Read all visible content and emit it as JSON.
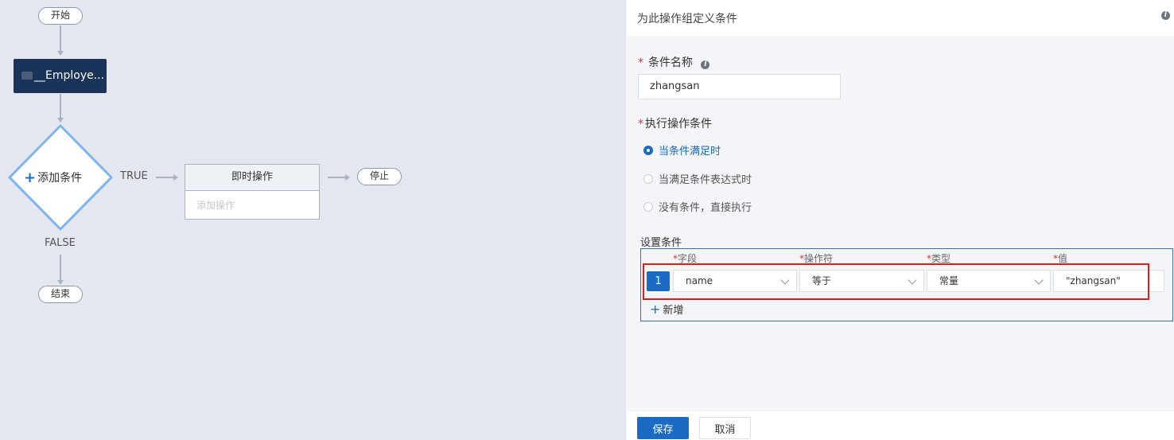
{
  "flow": {
    "start_label": "开始",
    "entity_label": "__Employe...",
    "condition_label": "添加条件",
    "true_label": "TRUE",
    "false_label": "FALSE",
    "action_header": "即时操作",
    "action_placeholder": "添加操作",
    "stop_label": "停止",
    "end_label": "结束"
  },
  "panel": {
    "title": "为此操作组定义条件",
    "condition_name_label": "条件名称",
    "condition_name_value": "zhangsan",
    "exec_label": "执行操作条件",
    "radio_options": [
      "当条件满足时",
      "当满足条件表达式时",
      "没有条件，直接执行"
    ],
    "selected_option": "当条件满足时",
    "set_conditions_label": "设置条件",
    "columns": {
      "field": "字段",
      "operator": "操作符",
      "type": "类型",
      "value": "值",
      "required_mark": "*"
    },
    "rows": [
      {
        "index": "1",
        "field": "name",
        "operator": "等于",
        "type": "常量",
        "value": "\"zhangsan\""
      }
    ],
    "add_row_label": "新增",
    "save_label": "保存",
    "cancel_label": "取消"
  },
  "colors": {
    "accent": "#1a6bc4",
    "node_dark": "#1a3358",
    "highlight": "#e01c1c",
    "required": "#e0322e"
  }
}
